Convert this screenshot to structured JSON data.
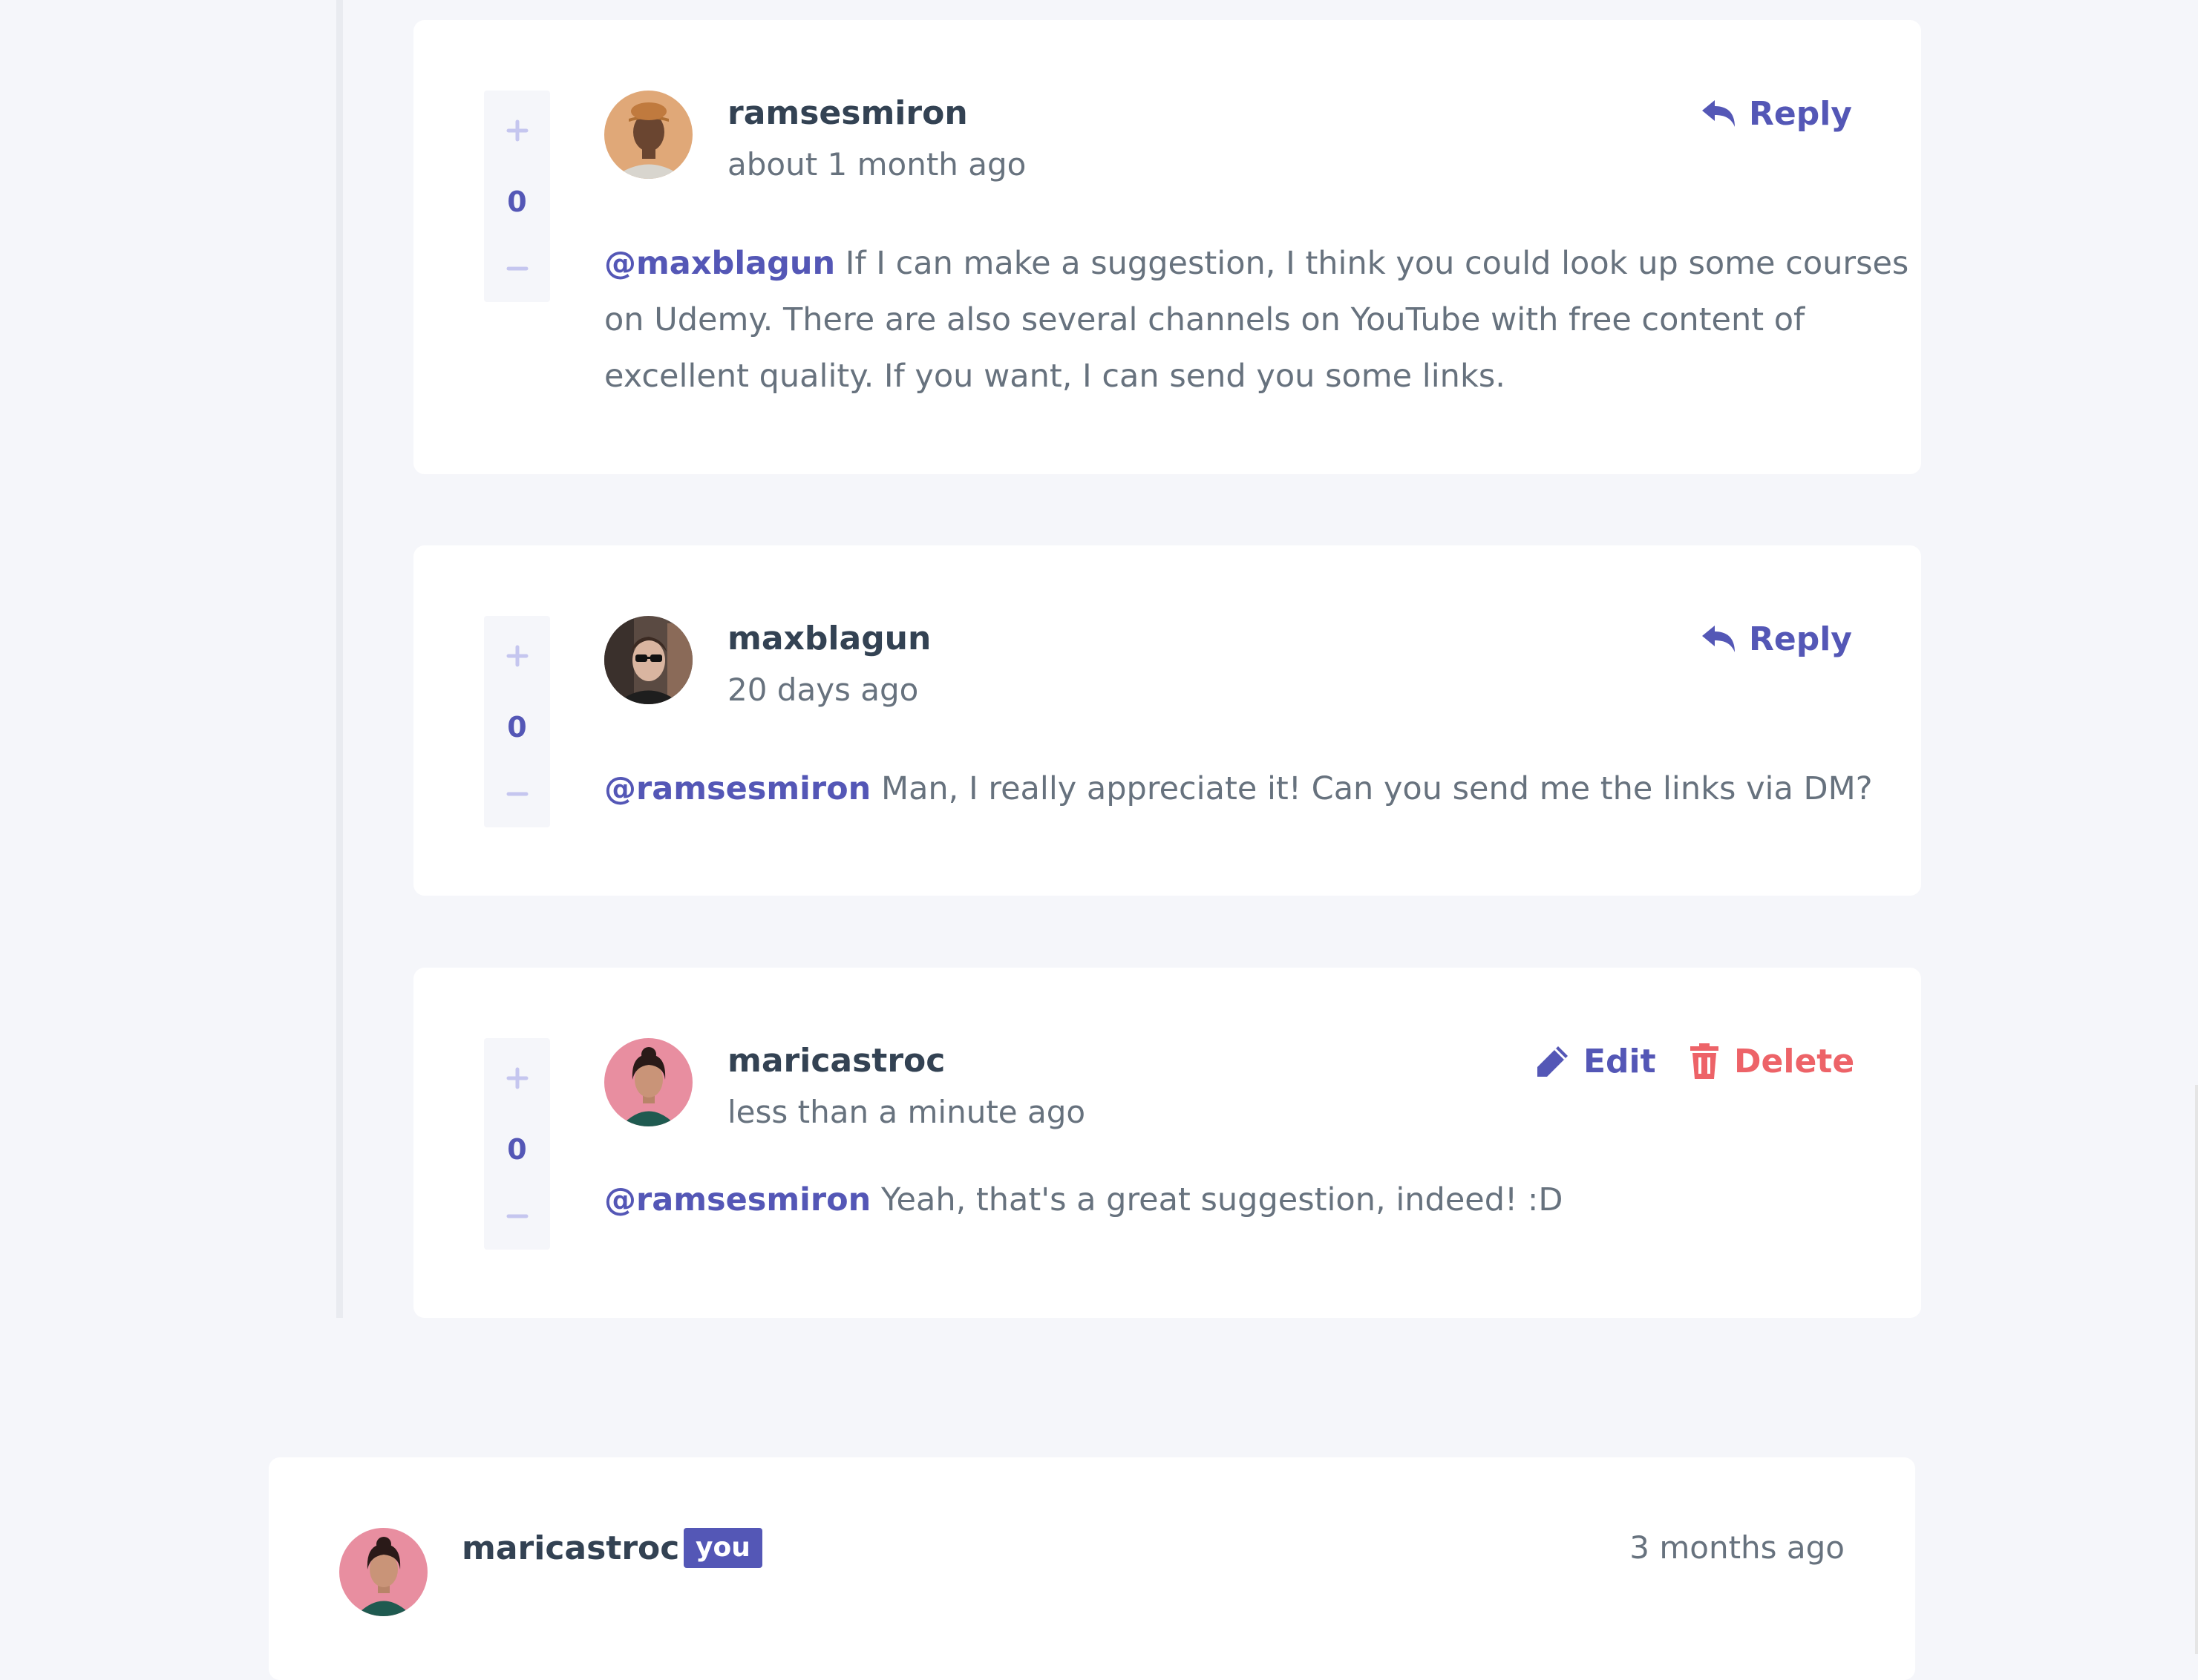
{
  "comments": [
    {
      "username": "ramsesmiron",
      "timestamp": "about 1 month ago",
      "score": "0",
      "action": "Reply",
      "mention": "@maxblagun",
      "text": "If I can make a suggestion, I think you could look up some courses on Udemy. There are also several channels on YouTube with free content of excellent quality. If you want, I can send you some links."
    },
    {
      "username": "maxblagun",
      "timestamp": "20 days ago",
      "score": "0",
      "action": "Reply",
      "mention": "@ramsesmiron",
      "text": "Man, I really appreciate it! Can you send me the links via DM?"
    },
    {
      "username": "maricastroc",
      "timestamp": "less than a minute ago",
      "score": "0",
      "edit_label": "Edit",
      "delete_label": "Delete",
      "mention": "@ramsesmiron",
      "text": "Yeah, that's a great suggestion, indeed! :D"
    }
  ],
  "current_comment": {
    "username": "maricastroc",
    "badge": "you",
    "timestamp": "3 months ago"
  },
  "icons": {
    "plus": "plus-icon",
    "minus": "minus-icon",
    "reply": "reply-icon",
    "edit": "pencil-icon",
    "delete": "trash-icon"
  },
  "colors": {
    "background": "#f5f6fa",
    "card": "#ffffff",
    "primary": "#5457b6",
    "danger": "#ed6368",
    "vote_icon": "#c5c6ef",
    "heading": "#334253",
    "text": "#67727e"
  }
}
